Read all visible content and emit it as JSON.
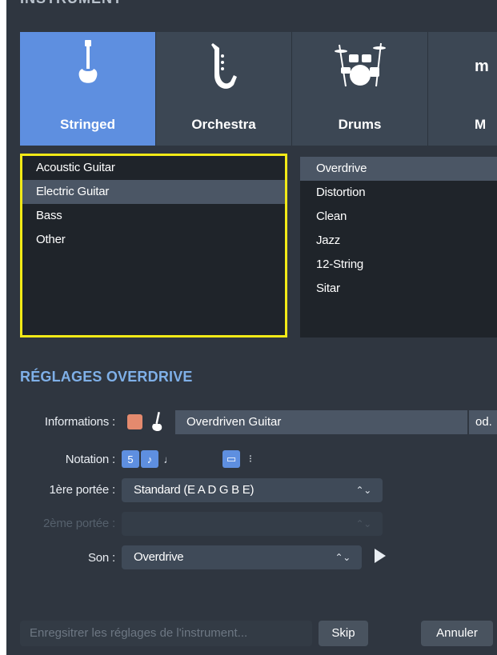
{
  "header": {
    "title": "INSTRUMENT"
  },
  "tabs": [
    {
      "label": "Stringed",
      "icon": "electric-guitar-icon",
      "active": true
    },
    {
      "label": "Orchestra",
      "icon": "saxophone-icon",
      "active": false
    },
    {
      "label": "Drums",
      "icon": "drum-kit-icon",
      "active": false
    },
    {
      "label": "M",
      "icon_text": "m",
      "icon": "keyboard-icon",
      "active": false
    }
  ],
  "instrument_list": {
    "items": [
      "Acoustic Guitar",
      "Electric Guitar",
      "Bass",
      "Other"
    ],
    "selected": "Electric Guitar"
  },
  "preset_list": {
    "items": [
      "Overdrive",
      "Distortion",
      "Clean",
      "Jazz",
      "12-String",
      "Sitar"
    ],
    "selected": "Overdrive"
  },
  "settings": {
    "title": "RÉGLAGES OVERDRIVE",
    "informations_label": "Informations :",
    "color": "#e48a6e",
    "instrument_name": "Overdriven Guitar",
    "abbreviation": "od.",
    "notation_label": "Notation :",
    "notation_buttons": [
      "5",
      "♪",
      "♩",
      "▭",
      "⁝"
    ],
    "first_staff_label": "1ère portée :",
    "first_staff_value": "Standard (E A D G B E)",
    "second_staff_label": "2ème portée :",
    "second_staff_value": "",
    "sound_label": "Son :",
    "sound_value": "Overdrive"
  },
  "footer": {
    "save_placeholder": "Enregsitrer les réglages de l'instrument...",
    "skip_label": "Skip",
    "cancel_label": "Annuler"
  },
  "colors": {
    "accent": "#5e8fe0",
    "highlight_border": "#f2ea17",
    "section_title": "#7fb0e8",
    "background": "#2f3640"
  }
}
